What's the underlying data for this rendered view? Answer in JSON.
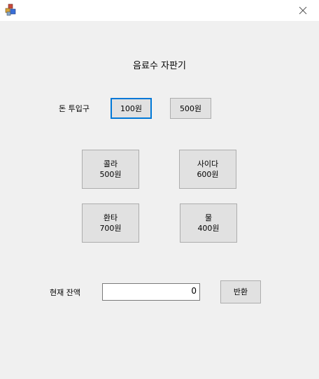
{
  "window": {
    "app_icon": "app-blocks-icon",
    "close_icon": "close-icon"
  },
  "header": {
    "title": "음료수 자판기"
  },
  "money_slot": {
    "label": "돈 투입구",
    "coin_100_label": "100원",
    "coin_500_label": "500원"
  },
  "drinks": [
    {
      "name": "콜라",
      "price": "500원"
    },
    {
      "name": "사이다",
      "price": "600원"
    },
    {
      "name": "환타",
      "price": "700원"
    },
    {
      "name": "물",
      "price": "400원"
    }
  ],
  "balance": {
    "label": "현재 잔액",
    "value": "0",
    "return_label": "반환"
  },
  "colors": {
    "focus_border": "#0078d7",
    "button_bg": "#e1e1e1",
    "form_bg": "#f0f0f0"
  }
}
